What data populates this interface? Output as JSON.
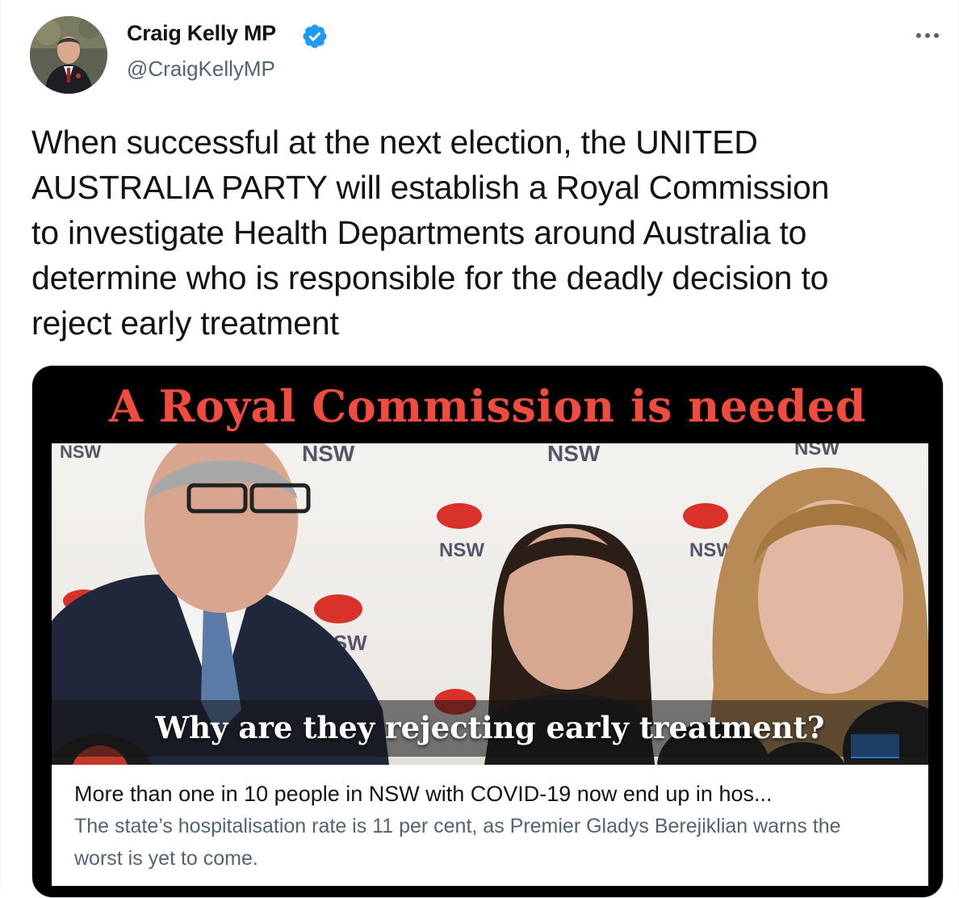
{
  "author": {
    "display_name": "Craig Kelly MP",
    "handle": "@CraigKellyMP",
    "verified": true
  },
  "tweet": {
    "text": "When successful at the next election, the UNITED\nAUSTRALIA PARTY will establish a Royal Commission\nto investigate Health Departments around Australia to\ndetermine who is responsible for the deadly decision to\nreject early treatment"
  },
  "card": {
    "headline": "A Royal Commission is needed",
    "caption": "Why are they rejecting early treatment?",
    "link_title": "More than one in 10 people in NSW with COVID-19 now end up in hos...",
    "link_description": "The state’s hospitalisation rate is 11 per cent, as Premier Gladys Berejiklian warns the worst is yet to come."
  },
  "icons": {
    "verified": "verified-badge-icon",
    "more": "more-options-icon"
  },
  "colors": {
    "verified_blue": "#1d9bf0",
    "headline_red": "#ef4b3f",
    "secondary_text": "#536471"
  }
}
